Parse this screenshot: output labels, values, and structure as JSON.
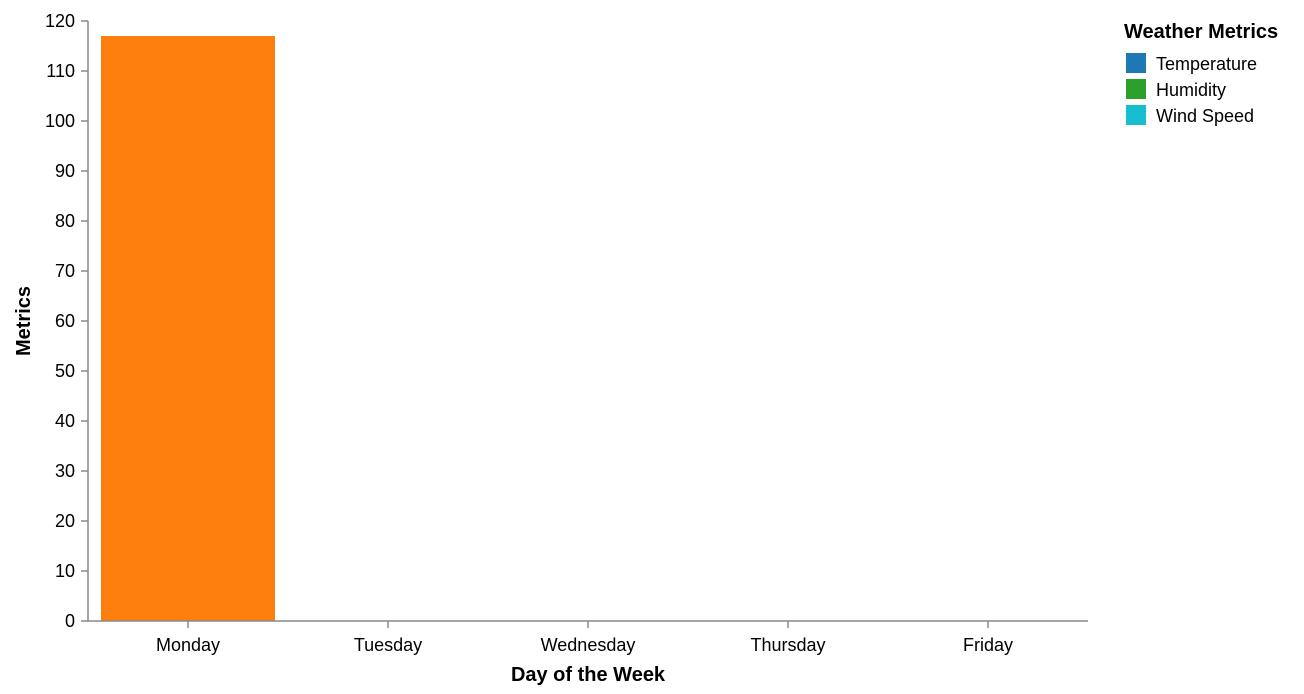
{
  "chart_data": {
    "type": "bar",
    "categories": [
      "Monday",
      "Tuesday",
      "Wednesday",
      "Thursday",
      "Friday"
    ],
    "series": [
      {
        "name": "",
        "color": "#ff7f0e",
        "values": [
          117,
          0,
          0,
          0,
          0
        ]
      }
    ],
    "xlabel": "Day of the Week",
    "ylabel": "Metrics",
    "ylim": [
      0,
      120
    ],
    "yticks": [
      0,
      10,
      20,
      30,
      40,
      50,
      60,
      70,
      80,
      90,
      100,
      110,
      120
    ],
    "grid": false,
    "legend": {
      "title": "Weather Metrics",
      "placement": "top-right",
      "items": [
        {
          "label": "Temperature",
          "color": "#1f77b4"
        },
        {
          "label": "Humidity",
          "color": "#2ca02c"
        },
        {
          "label": "Wind Speed",
          "color": "#17becf"
        }
      ]
    }
  }
}
